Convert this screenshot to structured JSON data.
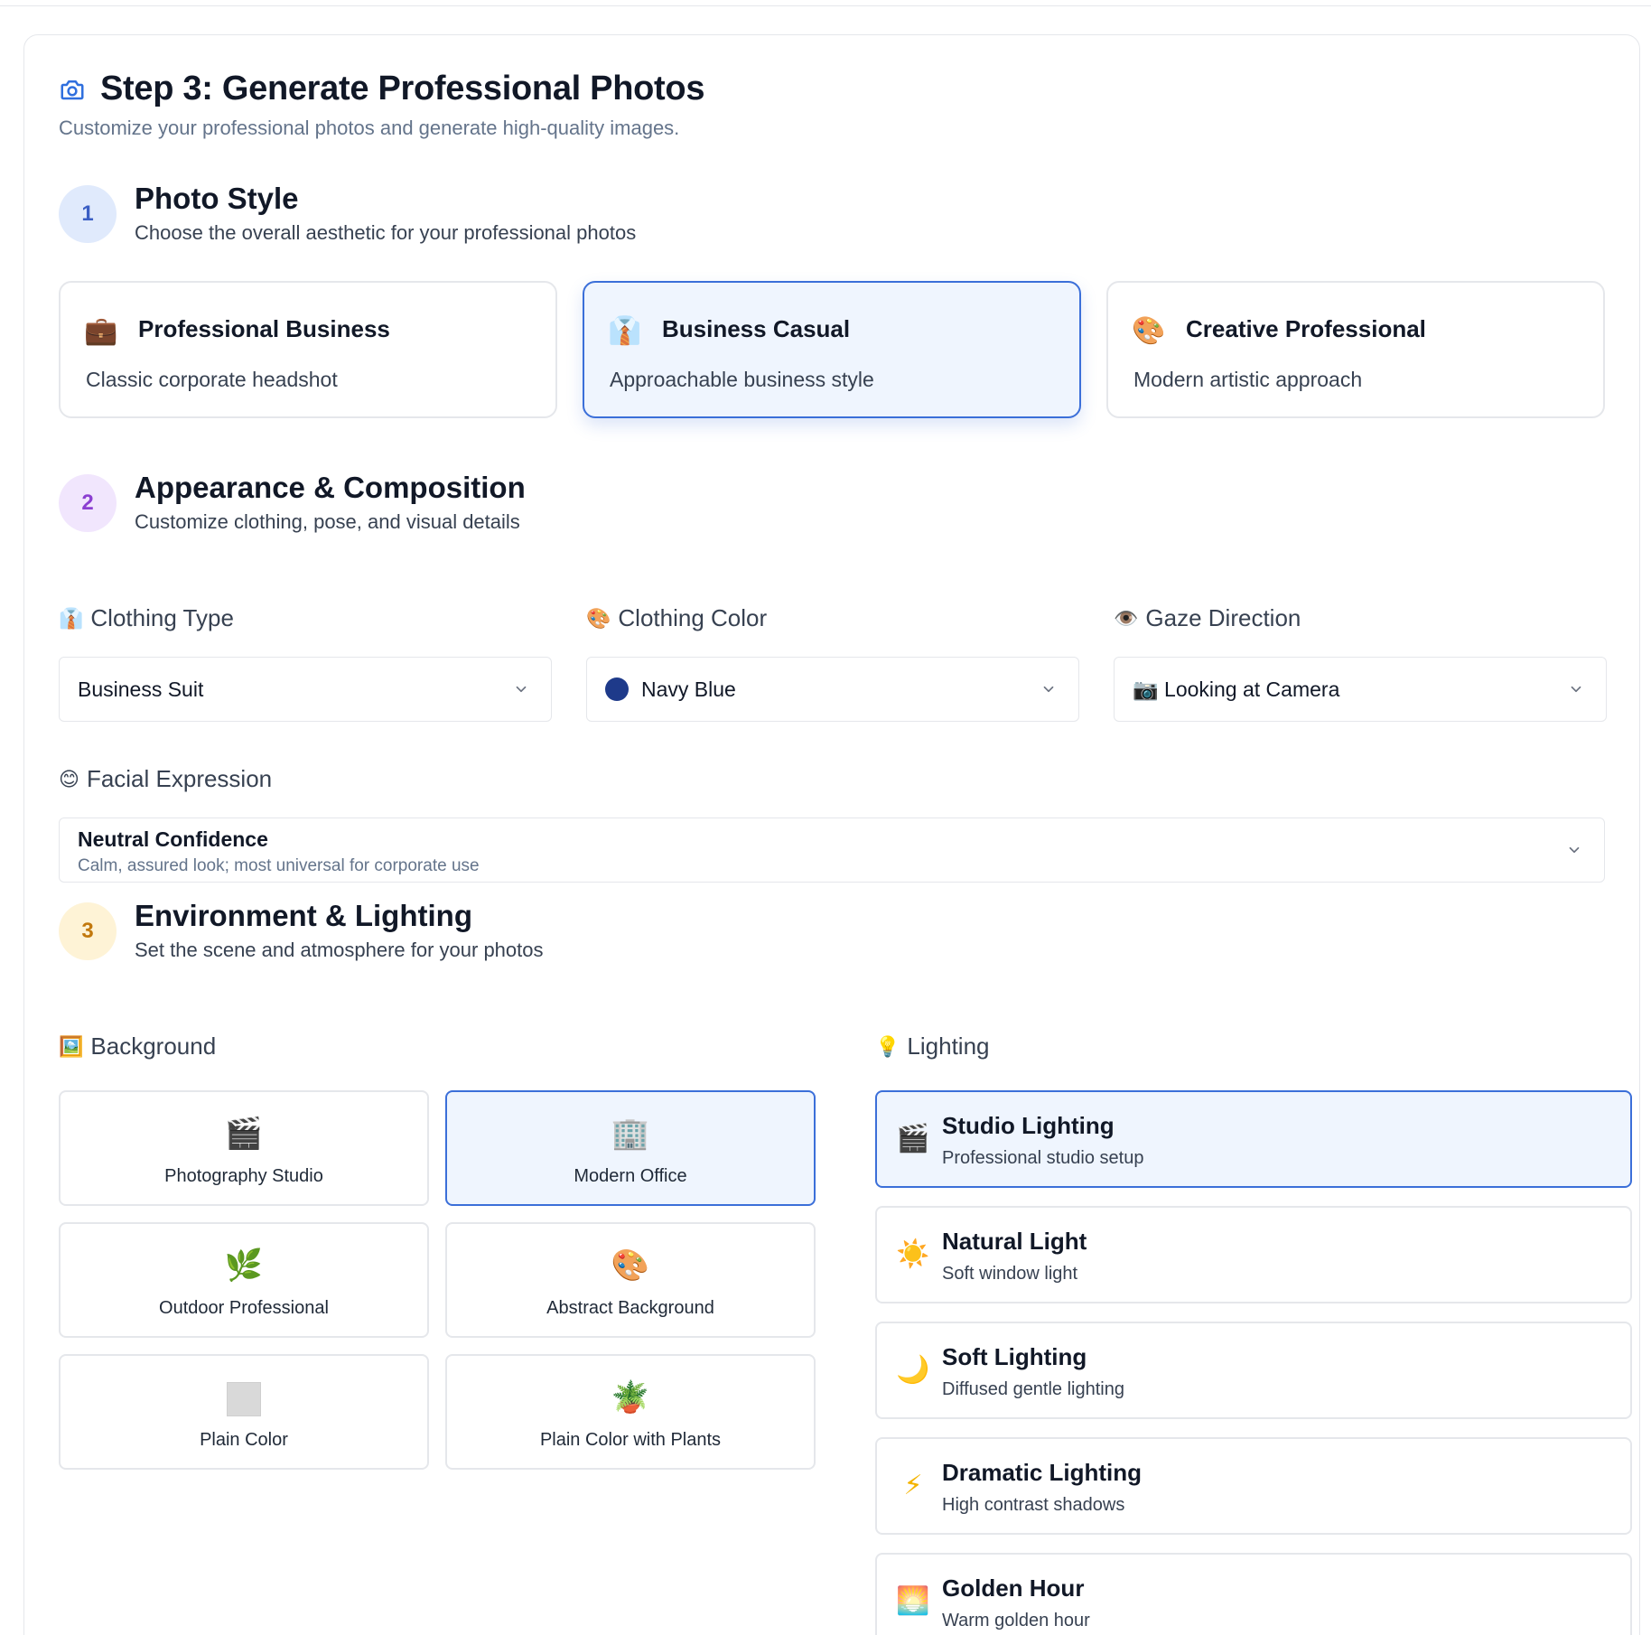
{
  "header": {
    "title": "Step 3: Generate Professional Photos",
    "subtitle": "Customize your professional photos and generate high-quality images."
  },
  "sections": [
    {
      "number": "1",
      "title": "Photo Style",
      "subtitle": "Choose the overall aesthetic for your professional photos"
    },
    {
      "number": "2",
      "title": "Appearance & Composition",
      "subtitle": "Customize clothing, pose, and visual details"
    },
    {
      "number": "3",
      "title": "Environment & Lighting",
      "subtitle": "Set the scene and atmosphere for your photos"
    }
  ],
  "styles": [
    {
      "icon": "💼",
      "title": "Professional Business",
      "desc": "Classic corporate headshot",
      "selected": false
    },
    {
      "icon": "👔",
      "title": "Business Casual",
      "desc": "Approachable business style",
      "selected": true
    },
    {
      "icon": "🎨",
      "title": "Creative Professional",
      "desc": "Modern artistic approach",
      "selected": false
    }
  ],
  "fields": {
    "clothing_type": {
      "icon": "👔",
      "label": "Clothing Type",
      "value": "Business Suit"
    },
    "clothing_color": {
      "icon": "🎨",
      "label": "Clothing Color",
      "value": "Navy Blue",
      "swatch": "#1e3a8a"
    },
    "gaze_direction": {
      "icon": "👁️",
      "label": "Gaze Direction",
      "value": "📷 Looking at Camera"
    },
    "facial_expression": {
      "icon": "😊",
      "label": "Facial Expression",
      "value": "Neutral Confidence",
      "desc": "Calm, assured look; most universal for corporate use"
    }
  },
  "background": {
    "icon": "🖼️",
    "label": "Background",
    "options": [
      {
        "icon": "🎬",
        "label": "Photography Studio",
        "selected": false
      },
      {
        "icon": "🏢",
        "label": "Modern Office",
        "selected": true
      },
      {
        "icon": "🌿",
        "label": "Outdoor Professional",
        "selected": false
      },
      {
        "icon": "🎨",
        "label": "Abstract Background",
        "selected": false
      },
      {
        "icon": "",
        "label": "Plain Color",
        "selected": false
      },
      {
        "icon": "🪴",
        "label": "Plain Color with Plants",
        "selected": false
      }
    ]
  },
  "lighting": {
    "icon": "💡",
    "label": "Lighting",
    "options": [
      {
        "icon": "🎬",
        "title": "Studio Lighting",
        "desc": "Professional studio setup",
        "selected": true
      },
      {
        "icon": "☀️",
        "title": "Natural Light",
        "desc": "Soft window light",
        "selected": false
      },
      {
        "icon": "🌙",
        "title": "Soft Lighting",
        "desc": "Diffused gentle lighting",
        "selected": false
      },
      {
        "icon": "⚡",
        "title": "Dramatic Lighting",
        "desc": "High contrast shadows",
        "selected": false
      },
      {
        "icon": "🌅",
        "title": "Golden Hour",
        "desc": "Warm golden hour",
        "selected": false
      }
    ]
  },
  "colors": {
    "accent": "#3b6fd9",
    "selected_bg": "#eff5fe",
    "step1_bg": "#e0eafc",
    "step1_fg": "#3b5fc4",
    "step2_bg": "#f1e6fd",
    "step2_fg": "#8b3fd1",
    "step3_bg": "#fef3d6",
    "step3_fg": "#c2780d"
  }
}
